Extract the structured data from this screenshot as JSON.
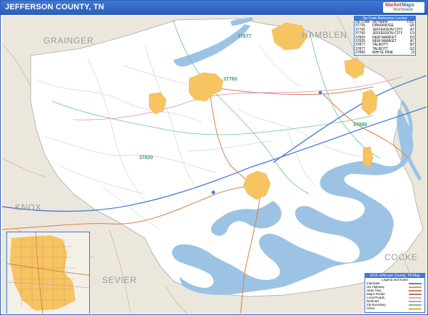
{
  "header": {
    "title": "JEFFERSON COUNTY, TN",
    "logo_line1": "Market",
    "logo_line2": "Maps",
    "logo_line3": "Worldwide"
  },
  "neighbor_counties": [
    "GRAINGER",
    "HAMBLEN",
    "KNOX",
    "SEVIER",
    "COCKE"
  ],
  "zip_labels": [
    "37877",
    "37760",
    "37820",
    "37888"
  ],
  "zip_table": {
    "title": "Zip Code Reference Locator",
    "headers": [
      "Zip Code",
      "Zip Name",
      "LOC"
    ],
    "rows": [
      [
        "37725",
        "DANDRIDGE",
        "G5"
      ],
      [
        "37760",
        "JEFFERSON CITY",
        "A7"
      ],
      [
        "37760",
        "JEFFERSON CITY",
        "F3"
      ],
      [
        "37820",
        "NEW MARKET",
        "D3"
      ],
      [
        "37820",
        "NEW MARKET",
        "A7"
      ],
      [
        "37877",
        "TALBOTT",
        "B7"
      ],
      [
        "37877",
        "TALBOTT",
        "G2"
      ],
      [
        "37890",
        "WHITE PINE",
        "I3"
      ]
    ]
  },
  "legend": {
    "title": "2016 Jefferson County, TN Map",
    "subtitle": "Legend and Notes",
    "items": [
      {
        "label": "Interstate",
        "color": "#4f7fd0"
      },
      {
        "label": "US Highway",
        "color": "#d9a040"
      },
      {
        "label": "State Hwy",
        "color": "#d77f4a"
      },
      {
        "label": "Major Roads",
        "color": "#b07a60"
      },
      {
        "label": "Local Roads",
        "color": "#b9b9b9"
      },
      {
        "label": "Railroad",
        "color": "#e48fb8"
      },
      {
        "label": "Zip Boundary",
        "color": "#6fbf8f"
      },
      {
        "label": "Cities",
        "color": "#f5c060"
      }
    ]
  },
  "colors": {
    "title_bar": "#2f66c4",
    "county_fill": "#ffffff",
    "outside_fill": "#ece7dc",
    "water": "#9cc3e4",
    "city": "#f7c462",
    "interstate": "#4f7fd0",
    "state_hwy": "#d77f4a",
    "railroad": "#e48fb8",
    "zip_boundary": "#6fbf8f"
  }
}
